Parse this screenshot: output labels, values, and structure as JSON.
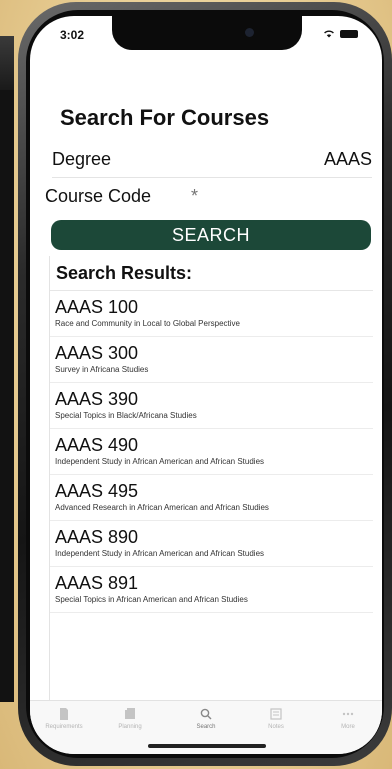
{
  "status_bar": {
    "time": "3:02",
    "wifi_icon": "wifi-icon",
    "battery_icon": "battery-icon"
  },
  "page": {
    "title": "Search For Courses"
  },
  "form": {
    "degree_label": "Degree",
    "degree_value": "AAAS",
    "course_code_label": "Course Code",
    "course_code_value": "",
    "course_code_placeholder": "*",
    "search_button_label": "SEARCH"
  },
  "results": {
    "heading": "Search Results:",
    "items": [
      {
        "code": "AAAS 100",
        "title": "Race and Community in Local to Global Perspective"
      },
      {
        "code": "AAAS 300",
        "title": "Survey in Africana Studies"
      },
      {
        "code": "AAAS 390",
        "title": "Special Topics in Black/Africana Studies"
      },
      {
        "code": "AAAS 490",
        "title": "Independent Study in African American and African Studies"
      },
      {
        "code": "AAAS 495",
        "title": "Advanced Research in African American and African Studies"
      },
      {
        "code": "AAAS 890",
        "title": "Independent Study in African American and African Studies"
      },
      {
        "code": "AAAS 891",
        "title": "Special Topics in African American and African Studies"
      }
    ]
  },
  "tab_bar": {
    "tabs": [
      {
        "label": "Requirements",
        "icon": "document-icon"
      },
      {
        "label": "Planning",
        "icon": "stack-icon"
      },
      {
        "label": "Search",
        "icon": "search-icon"
      },
      {
        "label": "Notes",
        "icon": "notes-icon"
      },
      {
        "label": "More",
        "icon": "more-icon"
      }
    ],
    "active_tab": "Search"
  },
  "colors": {
    "accent": "#1c4838",
    "background": "#e9cf96"
  }
}
